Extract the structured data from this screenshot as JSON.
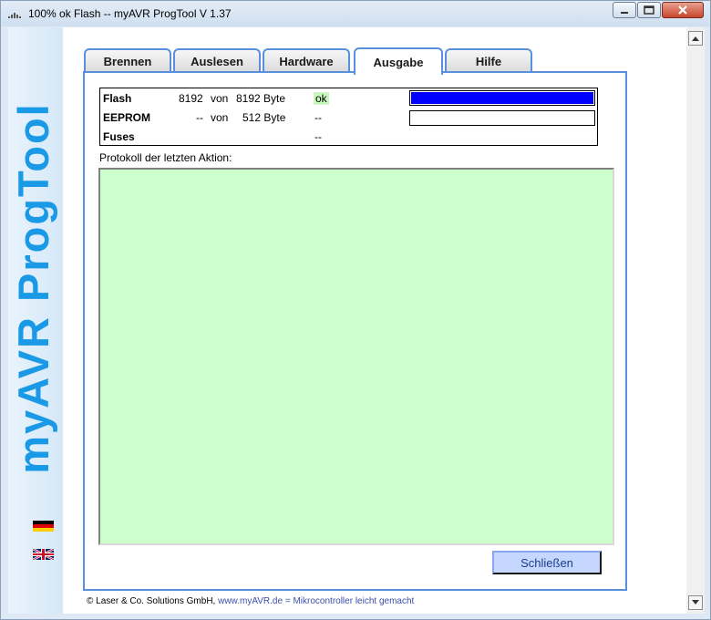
{
  "window": {
    "title": "100% ok Flash -- myAVR ProgTool V 1.37",
    "buttons": {
      "minimize": "minimize-icon",
      "maximize": "maximize-icon",
      "close": "close-icon"
    }
  },
  "sidebar": {
    "brand": "myAVR ProgTool",
    "languages": [
      "flag-germany-icon",
      "flag-uk-icon"
    ]
  },
  "tabs": [
    {
      "label": "Brennen"
    },
    {
      "label": "Auslesen"
    },
    {
      "label": "Hardware"
    },
    {
      "label": "Ausgabe",
      "active": true
    },
    {
      "label": "Hilfe"
    }
  ],
  "status": {
    "flash": {
      "label": "Flash",
      "value": "8192",
      "of": "von",
      "total": "8192 Byte",
      "state": "ok",
      "progress": 1.0
    },
    "eeprom": {
      "label": "EEPROM",
      "value": "--",
      "of": "von",
      "total": "512 Byte",
      "state": "--",
      "progress": 0.0
    },
    "fuses": {
      "label": "Fuses",
      "state": "--"
    }
  },
  "log": {
    "label": "Protokoll der letzten Aktion:",
    "content": ""
  },
  "close_button": "Schließen",
  "footer": {
    "company": "© Laser & Co. Solutions GmbH,",
    "website": "www.myAVR.de",
    "separator": "=",
    "slogan": "Mikrocontroller leicht gemacht"
  },
  "colors": {
    "accent": "#5a8fde",
    "brand": "#1a9ae6",
    "log_bg": "#ccffcc",
    "progress": "#0000ff",
    "ok_bg": "#c8f7c0",
    "button_bg": "#c5d6ff"
  }
}
